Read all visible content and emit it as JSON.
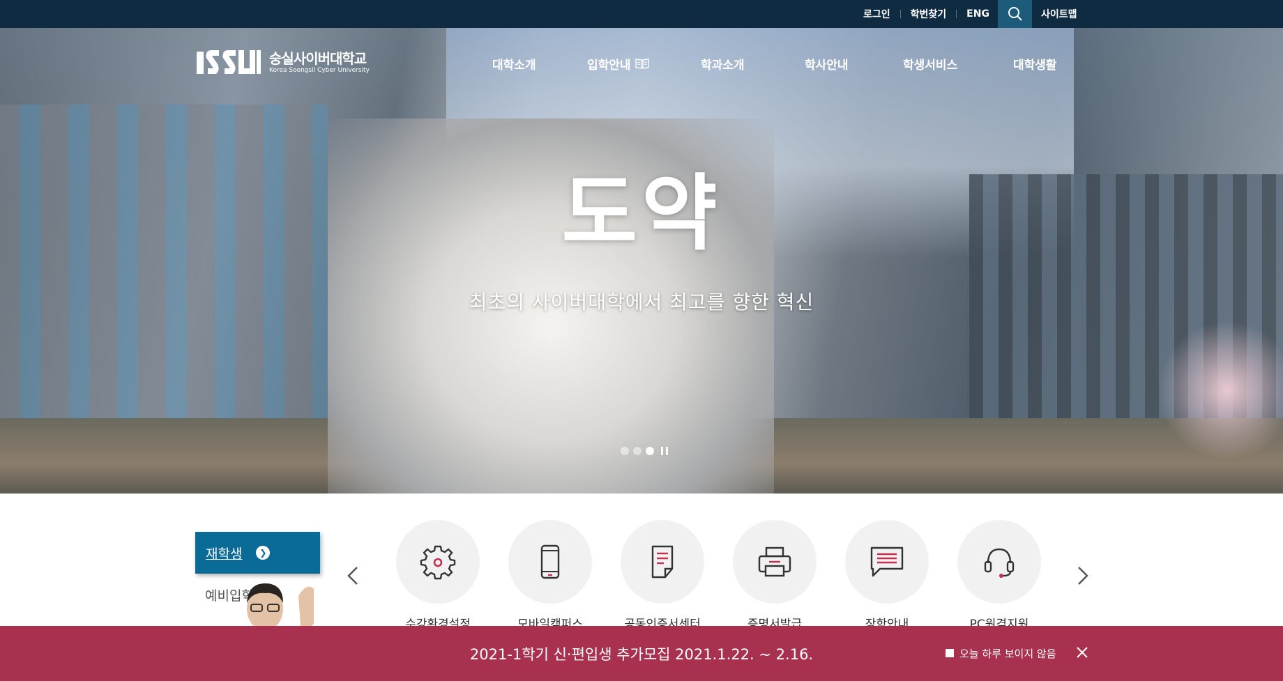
{
  "topbar": {
    "login": "로그인",
    "find_id": "학번찾기",
    "eng": "ENG",
    "sitemap": "사이트맵"
  },
  "logo": {
    "name_ko": "숭실사이버대학교",
    "name_en": "Korea Soongsil Cyber University"
  },
  "gnb": [
    {
      "label": "대학소개"
    },
    {
      "label": "입학안내"
    },
    {
      "label": "학과소개"
    },
    {
      "label": "학사안내"
    },
    {
      "label": "학생서비스"
    },
    {
      "label": "대학생활"
    }
  ],
  "hero": {
    "title": "도약",
    "subtitle": "최초의 사이버대학에서 최고를 향한 혁신",
    "slide_count": 3,
    "active_slide": 3
  },
  "quick_tabs": {
    "active": "재학생",
    "inactive": "예비입학생"
  },
  "quick_menu": [
    {
      "label": "수강환경설정",
      "icon": "gear-icon"
    },
    {
      "label": "모바일캠퍼스",
      "icon": "mobile-icon"
    },
    {
      "label": "공동인증서센터",
      "icon": "document-icon"
    },
    {
      "label": "증명서발급",
      "icon": "printer-icon"
    },
    {
      "label": "장학안내",
      "icon": "chat-icon"
    },
    {
      "label": "PC원격지원",
      "icon": "headset-icon"
    }
  ],
  "popup": {
    "message": "2021-1학기 신·편입생 추가모집 2021.1.22. ~ 2.16.",
    "hide_today": "오늘 하루 보이지 않음"
  },
  "colors": {
    "topbar": "#0f2b42",
    "search": "#1d5b7a",
    "tab_active": "#0a6b97",
    "popup": "#a8314f",
    "icon_accent": "#c0304f"
  }
}
